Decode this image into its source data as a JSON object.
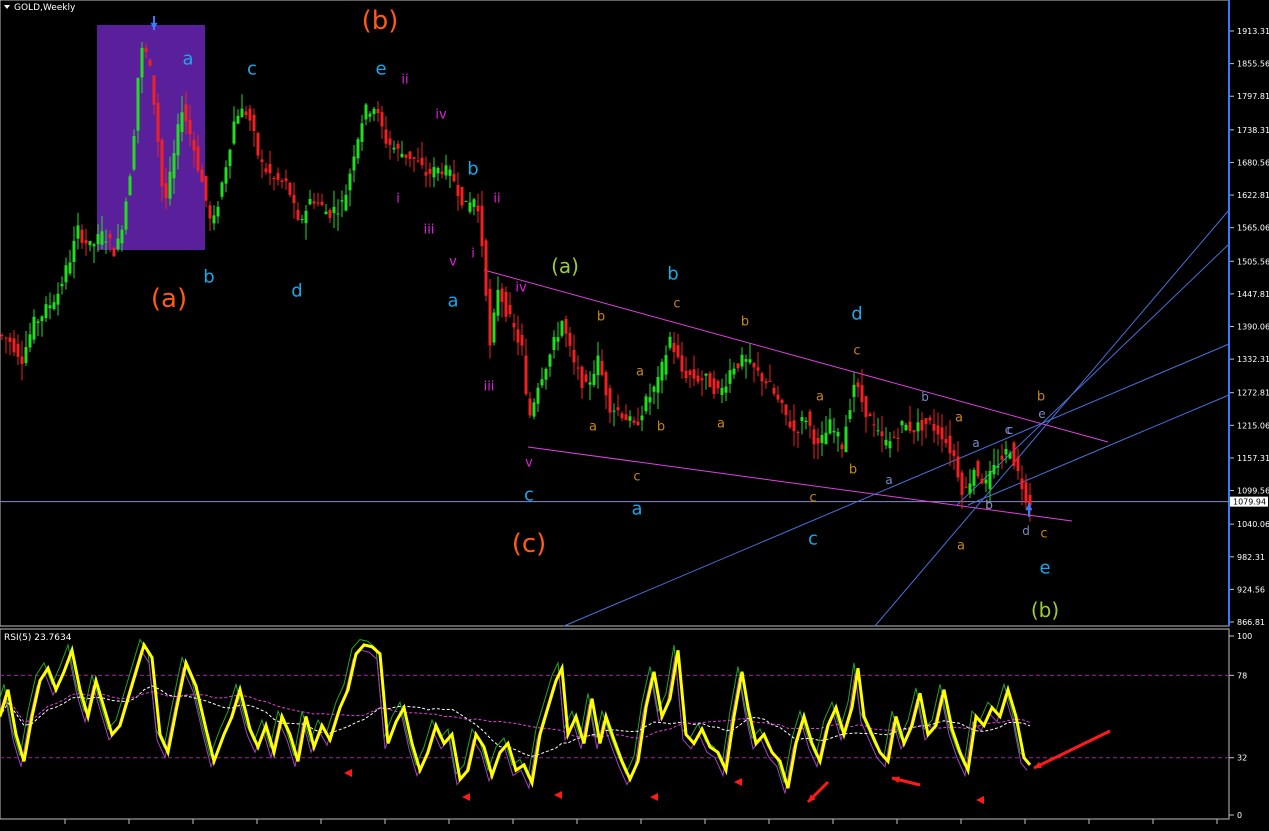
{
  "window": {
    "title": "GOLD,Weekly",
    "menu_icon": "triangle-down-icon"
  },
  "colors": {
    "background": "#000000",
    "axis": "#c0c0c0",
    "bull": "#22dd22",
    "bear": "#ee2222",
    "channel_magenta": "#e040e0",
    "blue_line": "#4a6fd8",
    "price_line": "#8a8ad8",
    "rsi_main": "#ffff00",
    "rsi_signal_green": "#1fa51f",
    "rsi_signal_purple": "#a040c0",
    "rsi_ma_white": "#ffffff",
    "rsi_ma_magenta": "#e040e0",
    "arrow_red": "#ff1a1a",
    "arrow_blue": "#3a7aff",
    "shaded_box": "#5a1f9a"
  },
  "chart_data": [
    {
      "type": "candlestick",
      "title": "GOLD,Weekly",
      "y_ticks": [
        "1913.31",
        "1855.56",
        "1797.81",
        "1738.31",
        "1680.56",
        "1622.81",
        "1565.06",
        "1505.56",
        "1447.81",
        "1390.06",
        "1332.31",
        "1272.81",
        "1215.06",
        "1157.31",
        "1099.56",
        "1040.06",
        "982.31",
        "924.56",
        "866.81"
      ],
      "y_tick_values": [
        1913.31,
        1855.56,
        1797.81,
        1738.31,
        1680.56,
        1622.81,
        1565.06,
        1505.56,
        1447.81,
        1390.06,
        1332.31,
        1272.81,
        1215.06,
        1157.31,
        1099.56,
        1040.06,
        982.31,
        924.56,
        866.81
      ],
      "current_price": "1079.94",
      "ylim": [
        866.81,
        1913.31
      ],
      "price_path": [
        [
          0,
          1375
        ],
        [
          12,
          1365
        ],
        [
          24,
          1335
        ],
        [
          36,
          1395
        ],
        [
          48,
          1420
        ],
        [
          60,
          1450
        ],
        [
          72,
          1510
        ],
        [
          80,
          1560
        ],
        [
          92,
          1530
        ],
        [
          106,
          1555
        ],
        [
          118,
          1520
        ],
        [
          126,
          1590
        ],
        [
          134,
          1690
        ],
        [
          142,
          1880
        ],
        [
          150,
          1870
        ],
        [
          158,
          1760
        ],
        [
          166,
          1600
        ],
        [
          174,
          1670
        ],
        [
          184,
          1780
        ],
        [
          194,
          1720
        ],
        [
          206,
          1630
        ],
        [
          214,
          1560
        ],
        [
          226,
          1660
        ],
        [
          238,
          1770
        ],
        [
          250,
          1770
        ],
        [
          262,
          1680
        ],
        [
          276,
          1650
        ],
        [
          290,
          1640
        ],
        [
          300,
          1570
        ],
        [
          314,
          1620
        ],
        [
          330,
          1590
        ],
        [
          346,
          1610
        ],
        [
          356,
          1700
        ],
        [
          366,
          1770
        ],
        [
          376,
          1780
        ],
        [
          388,
          1720
        ],
        [
          400,
          1700
        ],
        [
          414,
          1690
        ],
        [
          428,
          1660
        ],
        [
          444,
          1670
        ],
        [
          456,
          1650
        ],
        [
          468,
          1600
        ],
        [
          478,
          1620
        ],
        [
          486,
          1510
        ],
        [
          492,
          1350
        ],
        [
          500,
          1460
        ],
        [
          512,
          1400
        ],
        [
          524,
          1350
        ],
        [
          530,
          1220
        ],
        [
          540,
          1290
        ],
        [
          552,
          1340
        ],
        [
          564,
          1400
        ],
        [
          576,
          1320
        ],
        [
          588,
          1280
        ],
        [
          600,
          1330
        ],
        [
          612,
          1250
        ],
        [
          626,
          1235
        ],
        [
          636,
          1210
        ],
        [
          646,
          1250
        ],
        [
          660,
          1290
        ],
        [
          672,
          1370
        ],
        [
          684,
          1310
        ],
        [
          696,
          1300
        ],
        [
          710,
          1295
        ],
        [
          722,
          1270
        ],
        [
          734,
          1320
        ],
        [
          746,
          1330
        ],
        [
          758,
          1310
        ],
        [
          770,
          1290
        ],
        [
          782,
          1250
        ],
        [
          796,
          1205
        ],
        [
          808,
          1230
        ],
        [
          820,
          1175
        ],
        [
          832,
          1215
        ],
        [
          844,
          1180
        ],
        [
          856,
          1290
        ],
        [
          866,
          1250
        ],
        [
          878,
          1200
        ],
        [
          890,
          1180
        ],
        [
          904,
          1215
        ],
        [
          916,
          1210
        ],
        [
          930,
          1220
        ],
        [
          944,
          1200
        ],
        [
          956,
          1160
        ],
        [
          966,
          1090
        ],
        [
          976,
          1140
        ],
        [
          988,
          1110
        ],
        [
          1000,
          1150
        ],
        [
          1012,
          1175
        ],
        [
          1020,
          1130
        ],
        [
          1030,
          1080
        ]
      ],
      "labels": [
        {
          "text": "(b)",
          "color": "#ff5a1a"
        },
        {
          "text": "a",
          "color": "#1aa8e8"
        },
        {
          "text": "c",
          "color": "#1aa8e8"
        },
        {
          "text": "e",
          "color": "#1aa8e8"
        },
        {
          "text": "ii",
          "color": "#e020e0"
        },
        {
          "text": "iv",
          "color": "#e020e0"
        },
        {
          "text": "b",
          "color": "#1aa8e8"
        },
        {
          "text": "ii",
          "color": "#e020e0"
        },
        {
          "text": "i",
          "color": "#e020e0"
        },
        {
          "text": "iii",
          "color": "#e020e0"
        },
        {
          "text": "v",
          "color": "#e020e0"
        },
        {
          "text": "i",
          "color": "#e020e0"
        },
        {
          "text": "(a)",
          "color": "#ff5a1a"
        },
        {
          "text": "b",
          "color": "#1aa8e8"
        },
        {
          "text": "d",
          "color": "#1aa8e8"
        },
        {
          "text": "(a)",
          "color": "#9acd32"
        },
        {
          "text": "b",
          "color": "#1aa8e8"
        },
        {
          "text": "iv",
          "color": "#e020e0"
        },
        {
          "text": "a",
          "color": "#1aa8e8"
        },
        {
          "text": "c",
          "color": "#c8861a"
        },
        {
          "text": "b",
          "color": "#c8861a"
        },
        {
          "text": "b",
          "color": "#c8861a"
        },
        {
          "text": "d",
          "color": "#1aa8e8"
        },
        {
          "text": "c",
          "color": "#c8861a"
        },
        {
          "text": "iii",
          "color": "#e020e0"
        },
        {
          "text": "a",
          "color": "#c8861a"
        },
        {
          "text": "a",
          "color": "#c8861a"
        },
        {
          "text": "a",
          "color": "#c8861a"
        },
        {
          "text": "b",
          "color": "#c8861a"
        },
        {
          "text": "a",
          "color": "#c8861a"
        },
        {
          "text": "b",
          "color": "#7a8ac8"
        },
        {
          "text": "b",
          "color": "#c8861a"
        },
        {
          "text": "e",
          "color": "#7a8ac8"
        },
        {
          "text": "a",
          "color": "#c8861a"
        },
        {
          "text": "b",
          "color": "#c8861a"
        },
        {
          "text": "c",
          "color": "#7a8ac8"
        },
        {
          "text": "v",
          "color": "#e020e0"
        },
        {
          "text": "c",
          "color": "#c8861a"
        },
        {
          "text": "b",
          "color": "#c8861a"
        },
        {
          "text": "a",
          "color": "#7a8ac8"
        },
        {
          "text": "a",
          "color": "#7a8ac8"
        },
        {
          "text": "c",
          "color": "#1aa8e8"
        },
        {
          "text": "c",
          "color": "#c8861a"
        },
        {
          "text": "b",
          "color": "#7a8ac8"
        },
        {
          "text": "c",
          "color": "#7a8ac8"
        },
        {
          "text": "a",
          "color": "#1aa8e8"
        },
        {
          "text": "d",
          "color": "#7a8ac8"
        },
        {
          "text": "c",
          "color": "#c8861a"
        },
        {
          "text": "(c)",
          "color": "#ff5a1a"
        },
        {
          "text": "a",
          "color": "#c8861a"
        },
        {
          "text": "c",
          "color": "#1aa8e8"
        },
        {
          "text": "e",
          "color": "#1aa8e8"
        },
        {
          "text": "(b)",
          "color": "#9acd32"
        }
      ]
    },
    {
      "type": "line",
      "title": "RSI(5) 23.7634",
      "y_ticks": [
        "100",
        "78",
        "32",
        "0"
      ],
      "y_tick_values": [
        100,
        78,
        32,
        0
      ],
      "ylim": [
        0,
        100
      ],
      "levels": [
        78,
        32
      ],
      "rsi_path": [
        [
          0,
          55
        ],
        [
          8,
          70
        ],
        [
          16,
          45
        ],
        [
          24,
          30
        ],
        [
          32,
          55
        ],
        [
          40,
          75
        ],
        [
          48,
          82
        ],
        [
          56,
          70
        ],
        [
          64,
          80
        ],
        [
          72,
          92
        ],
        [
          80,
          70
        ],
        [
          88,
          55
        ],
        [
          96,
          75
        ],
        [
          104,
          60
        ],
        [
          112,
          45
        ],
        [
          120,
          50
        ],
        [
          128,
          65
        ],
        [
          136,
          80
        ],
        [
          144,
          95
        ],
        [
          152,
          88
        ],
        [
          160,
          45
        ],
        [
          168,
          35
        ],
        [
          176,
          58
        ],
        [
          186,
          85
        ],
        [
          196,
          72
        ],
        [
          206,
          48
        ],
        [
          214,
          30
        ],
        [
          224,
          45
        ],
        [
          232,
          55
        ],
        [
          240,
          70
        ],
        [
          250,
          48
        ],
        [
          258,
          38
        ],
        [
          266,
          50
        ],
        [
          274,
          35
        ],
        [
          282,
          55
        ],
        [
          290,
          45
        ],
        [
          298,
          30
        ],
        [
          306,
          55
        ],
        [
          314,
          38
        ],
        [
          322,
          50
        ],
        [
          330,
          42
        ],
        [
          340,
          60
        ],
        [
          348,
          70
        ],
        [
          356,
          90
        ],
        [
          364,
          95
        ],
        [
          372,
          94
        ],
        [
          380,
          90
        ],
        [
          388,
          40
        ],
        [
          396,
          52
        ],
        [
          404,
          60
        ],
        [
          412,
          40
        ],
        [
          420,
          25
        ],
        [
          428,
          35
        ],
        [
          436,
          50
        ],
        [
          444,
          40
        ],
        [
          452,
          45
        ],
        [
          460,
          20
        ],
        [
          468,
          25
        ],
        [
          476,
          45
        ],
        [
          484,
          38
        ],
        [
          492,
          22
        ],
        [
          500,
          35
        ],
        [
          508,
          40
        ],
        [
          516,
          25
        ],
        [
          524,
          28
        ],
        [
          532,
          18
        ],
        [
          540,
          45
        ],
        [
          548,
          60
        ],
        [
          556,
          75
        ],
        [
          562,
          82
        ],
        [
          568,
          45
        ],
        [
          576,
          55
        ],
        [
          584,
          40
        ],
        [
          592,
          65
        ],
        [
          600,
          40
        ],
        [
          606,
          55
        ],
        [
          614,
          42
        ],
        [
          622,
          30
        ],
        [
          630,
          20
        ],
        [
          638,
          30
        ],
        [
          646,
          60
        ],
        [
          654,
          80
        ],
        [
          662,
          55
        ],
        [
          670,
          65
        ],
        [
          678,
          92
        ],
        [
          686,
          45
        ],
        [
          694,
          40
        ],
        [
          702,
          48
        ],
        [
          710,
          38
        ],
        [
          718,
          35
        ],
        [
          726,
          25
        ],
        [
          734,
          55
        ],
        [
          742,
          80
        ],
        [
          748,
          60
        ],
        [
          756,
          40
        ],
        [
          764,
          45
        ],
        [
          772,
          35
        ],
        [
          780,
          30
        ],
        [
          788,
          15
        ],
        [
          796,
          40
        ],
        [
          804,
          55
        ],
        [
          812,
          40
        ],
        [
          820,
          30
        ],
        [
          828,
          50
        ],
        [
          836,
          60
        ],
        [
          844,
          45
        ],
        [
          852,
          60
        ],
        [
          858,
          82
        ],
        [
          864,
          55
        ],
        [
          872,
          45
        ],
        [
          880,
          35
        ],
        [
          888,
          30
        ],
        [
          896,
          55
        ],
        [
          904,
          40
        ],
        [
          912,
          50
        ],
        [
          920,
          68
        ],
        [
          928,
          45
        ],
        [
          936,
          50
        ],
        [
          944,
          70
        ],
        [
          952,
          48
        ],
        [
          960,
          35
        ],
        [
          968,
          25
        ],
        [
          976,
          55
        ],
        [
          984,
          50
        ],
        [
          992,
          60
        ],
        [
          1000,
          55
        ],
        [
          1008,
          70
        ],
        [
          1016,
          55
        ],
        [
          1024,
          32
        ],
        [
          1030,
          28
        ]
      ]
    }
  ]
}
